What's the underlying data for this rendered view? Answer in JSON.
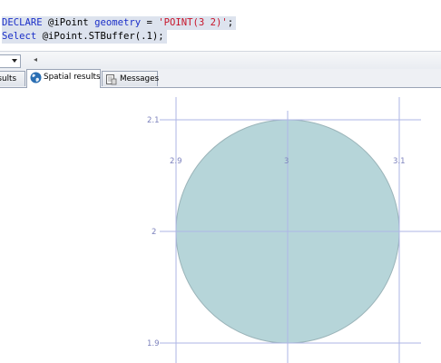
{
  "editor": {
    "line1": {
      "kw_declare": "DECLARE",
      "var": " @iPoint ",
      "type": "geometry",
      "eq": " = ",
      "str": "'POINT(3 2)'",
      "end": ";"
    },
    "line2": {
      "kw_select": "Select",
      "rest": " @iPoint.STBuffer(.1);"
    }
  },
  "toolbar": {
    "scroll_glyph": "◂"
  },
  "tabs": [
    {
      "label": "esults"
    },
    {
      "label": "Spatial results"
    },
    {
      "label": "Messages"
    }
  ],
  "plot": {
    "labels": {
      "y_top": "2.1",
      "y_mid": "2",
      "y_bottom": "1.9",
      "x_left": "2.9",
      "x_mid": "3",
      "x_right": "3.1"
    },
    "colors": {
      "fill": "#b6d5d9",
      "stroke": "#9bb4b9",
      "grid": "#aeb6e6"
    }
  }
}
